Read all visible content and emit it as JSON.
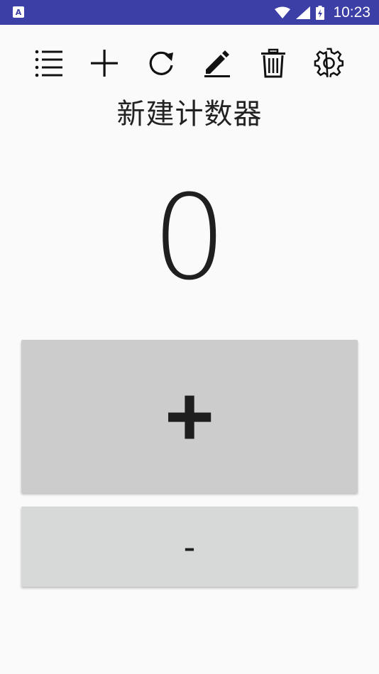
{
  "status_bar": {
    "notification_icon_glyph": "A",
    "time": "10:23",
    "icons": [
      "wifi-icon",
      "signal-icon",
      "battery-charging-icon"
    ]
  },
  "toolbar": {
    "buttons": [
      "list-icon",
      "add-icon",
      "refresh-icon",
      "edit-icon",
      "delete-icon",
      "settings-icon"
    ]
  },
  "counter": {
    "title": "新建计数器",
    "value": "0"
  },
  "actions": {
    "increment_label": "+",
    "decrement_label": "-"
  },
  "colors": {
    "status_bar": "#3C3FA5",
    "background": "#FAFAFA",
    "increment_button": "#CBCCCB",
    "decrement_button": "#D7D8D8",
    "text": "#1F1F1F"
  }
}
